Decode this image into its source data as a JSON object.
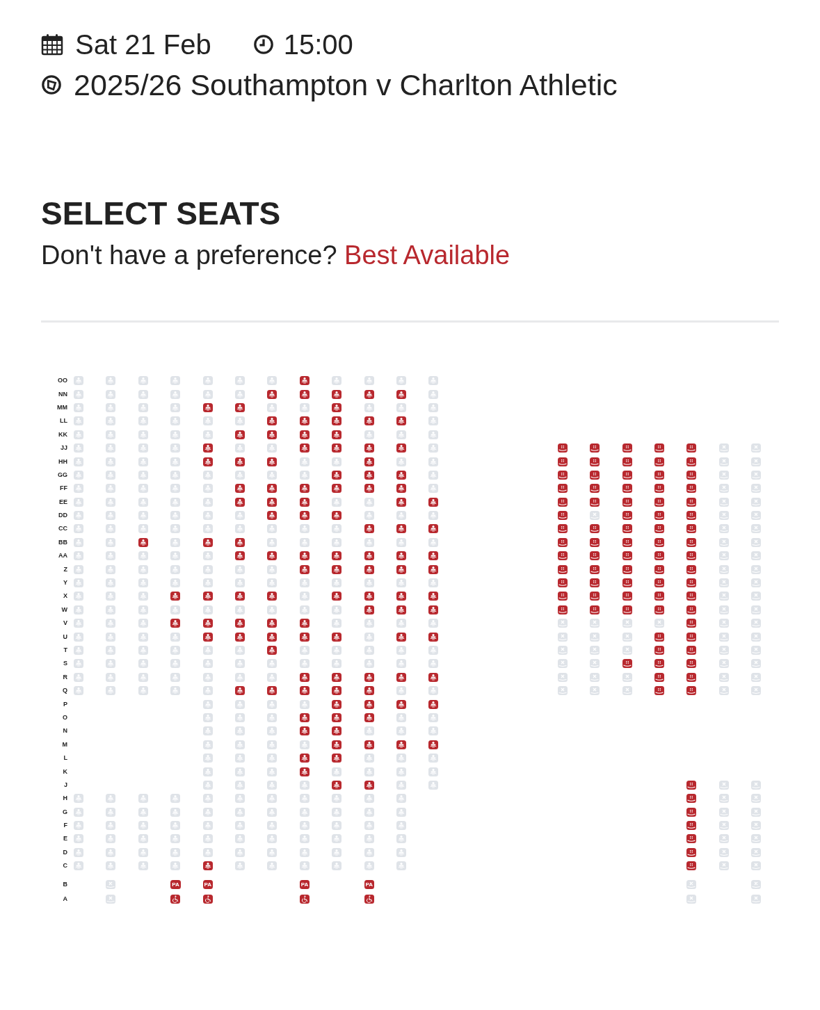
{
  "event": {
    "date": "Sat 21 Feb",
    "time": "15:00",
    "title": "2025/26 Southampton v Charlton Athletic"
  },
  "heading": {
    "title": "SELECT SEATS",
    "prompt": "Don't have a preference?",
    "link": "Best Available"
  },
  "seat_map": {
    "rows": [
      {
        "label": "OO",
        "kind": "standard",
        "left_seats": [
          false,
          false,
          false,
          false,
          false,
          false,
          false,
          true,
          false,
          false,
          false,
          false
        ]
      },
      {
        "label": "NN",
        "kind": "standard",
        "left_seats": [
          false,
          false,
          false,
          false,
          false,
          false,
          true,
          true,
          true,
          true,
          true,
          false
        ]
      },
      {
        "label": "MM",
        "kind": "standard",
        "left_seats": [
          false,
          false,
          false,
          false,
          true,
          true,
          false,
          false,
          true,
          false,
          false,
          false
        ]
      },
      {
        "label": "LL",
        "kind": "standard",
        "left_seats": [
          false,
          false,
          false,
          false,
          false,
          false,
          true,
          true,
          true,
          true,
          true,
          false
        ]
      },
      {
        "label": "KK",
        "kind": "standard",
        "left_seats": [
          false,
          false,
          false,
          false,
          false,
          true,
          true,
          true,
          true,
          false,
          false,
          false
        ]
      },
      {
        "label": "JJ",
        "kind": "standard",
        "left_seats": [
          false,
          false,
          false,
          false,
          true,
          false,
          false,
          true,
          true,
          true,
          true,
          false
        ],
        "right_seats": [
          true,
          true,
          true,
          true,
          true,
          false,
          false
        ]
      },
      {
        "label": "HH",
        "kind": "standard",
        "left_seats": [
          false,
          false,
          false,
          false,
          true,
          true,
          true,
          false,
          false,
          true,
          false,
          false
        ],
        "right_seats": [
          true,
          true,
          true,
          true,
          true,
          false,
          false
        ]
      },
      {
        "label": "GG",
        "kind": "standard",
        "left_seats": [
          false,
          false,
          false,
          false,
          false,
          false,
          false,
          false,
          true,
          true,
          true,
          false
        ],
        "right_seats": [
          true,
          true,
          true,
          true,
          true,
          false,
          false
        ]
      },
      {
        "label": "FF",
        "kind": "standard",
        "left_seats": [
          false,
          false,
          false,
          false,
          false,
          true,
          true,
          true,
          true,
          true,
          true,
          false
        ],
        "right_seats": [
          true,
          true,
          true,
          true,
          true,
          false,
          false
        ]
      },
      {
        "label": "EE",
        "kind": "standard",
        "left_seats": [
          false,
          false,
          false,
          false,
          false,
          true,
          true,
          true,
          false,
          false,
          true,
          true
        ],
        "right_seats": [
          true,
          true,
          true,
          true,
          true,
          false,
          false
        ]
      },
      {
        "label": "DD",
        "kind": "standard",
        "left_seats": [
          false,
          false,
          false,
          false,
          false,
          false,
          true,
          true,
          true,
          false,
          false,
          false
        ],
        "right_seats": [
          true,
          false,
          true,
          true,
          true,
          false,
          false
        ]
      },
      {
        "label": "CC",
        "kind": "standard",
        "left_seats": [
          false,
          false,
          false,
          false,
          false,
          false,
          false,
          false,
          false,
          true,
          true,
          true
        ],
        "right_seats": [
          true,
          true,
          true,
          true,
          true,
          false,
          false
        ]
      },
      {
        "label": "BB",
        "kind": "standard",
        "left_seats": [
          false,
          false,
          true,
          false,
          true,
          true,
          false,
          false,
          false,
          false,
          false,
          false
        ],
        "right_seats": [
          true,
          true,
          true,
          true,
          true,
          false,
          false
        ]
      },
      {
        "label": "AA",
        "kind": "standard",
        "left_seats": [
          false,
          false,
          false,
          false,
          false,
          true,
          true,
          true,
          true,
          true,
          true,
          true
        ],
        "right_seats": [
          true,
          true,
          true,
          true,
          true,
          false,
          false
        ]
      },
      {
        "label": "Z",
        "kind": "standard",
        "left_seats": [
          false,
          false,
          false,
          false,
          false,
          false,
          false,
          true,
          true,
          true,
          true,
          true
        ],
        "right_seats": [
          true,
          true,
          true,
          true,
          true,
          false,
          false
        ]
      },
      {
        "label": "Y",
        "kind": "standard",
        "left_seats": [
          false,
          false,
          false,
          false,
          false,
          false,
          false,
          false,
          false,
          false,
          false,
          false
        ],
        "right_seats": [
          true,
          true,
          true,
          true,
          true,
          false,
          false
        ]
      },
      {
        "label": "X",
        "kind": "standard",
        "left_seats": [
          false,
          false,
          false,
          true,
          true,
          true,
          true,
          false,
          true,
          true,
          true,
          true
        ],
        "right_seats": [
          true,
          true,
          true,
          true,
          true,
          false,
          false
        ]
      },
      {
        "label": "W",
        "kind": "standard",
        "left_seats": [
          false,
          false,
          false,
          false,
          false,
          false,
          false,
          false,
          false,
          true,
          true,
          true
        ],
        "right_seats": [
          true,
          true,
          true,
          true,
          true,
          false,
          false
        ]
      },
      {
        "label": "V",
        "kind": "standard",
        "left_seats": [
          false,
          false,
          false,
          true,
          true,
          true,
          true,
          true,
          false,
          false,
          false,
          false
        ],
        "right_seats": [
          false,
          false,
          false,
          false,
          true,
          false,
          false
        ]
      },
      {
        "label": "U",
        "kind": "standard",
        "left_seats": [
          false,
          false,
          false,
          false,
          true,
          true,
          true,
          true,
          true,
          false,
          true,
          true
        ],
        "right_seats": [
          false,
          false,
          false,
          true,
          true,
          false,
          false
        ]
      },
      {
        "label": "T",
        "kind": "standard",
        "left_seats": [
          false,
          false,
          false,
          false,
          false,
          false,
          true,
          false,
          false,
          false,
          false,
          false
        ],
        "right_seats": [
          false,
          false,
          false,
          true,
          true,
          false,
          false
        ]
      },
      {
        "label": "S",
        "kind": "standard",
        "left_seats": [
          false,
          false,
          false,
          false,
          false,
          false,
          false,
          false,
          false,
          false,
          false,
          false
        ],
        "right_seats": [
          false,
          false,
          true,
          true,
          true,
          false,
          false
        ]
      },
      {
        "label": "R",
        "kind": "standard",
        "left_seats": [
          false,
          false,
          false,
          false,
          false,
          false,
          false,
          true,
          true,
          true,
          true,
          true
        ],
        "right_seats": [
          false,
          false,
          false,
          true,
          true,
          false,
          false
        ]
      },
      {
        "label": "Q",
        "kind": "standard",
        "left_seats": [
          false,
          false,
          false,
          false,
          false,
          true,
          true,
          true,
          true,
          true,
          false,
          false
        ],
        "right_seats": [
          false,
          false,
          false,
          true,
          true,
          false,
          false
        ]
      },
      {
        "label": "P",
        "kind": "standard",
        "left_inset": true,
        "left_seats": [
          false,
          false,
          false,
          false,
          true,
          true,
          true,
          true
        ]
      },
      {
        "label": "O",
        "kind": "standard",
        "left_inset": true,
        "left_seats": [
          false,
          false,
          false,
          true,
          true,
          true,
          false,
          false
        ]
      },
      {
        "label": "N",
        "kind": "standard",
        "left_inset": true,
        "left_seats": [
          false,
          false,
          false,
          true,
          true,
          false,
          false,
          false
        ]
      },
      {
        "label": "M",
        "kind": "standard",
        "left_inset": true,
        "left_seats": [
          false,
          false,
          false,
          false,
          true,
          true,
          true,
          true
        ]
      },
      {
        "label": "L",
        "kind": "standard",
        "left_inset": true,
        "left_seats": [
          false,
          false,
          false,
          true,
          true,
          false,
          false,
          false
        ]
      },
      {
        "label": "K",
        "kind": "standard",
        "left_inset": true,
        "left_seats": [
          false,
          false,
          false,
          true,
          false,
          false,
          false,
          false
        ]
      },
      {
        "label": "J",
        "kind": "standard",
        "left_inset": true,
        "left_seats": [
          false,
          false,
          false,
          false,
          true,
          true,
          false,
          false
        ],
        "right_inset": true,
        "right_seats": [
          true,
          false,
          false
        ]
      },
      {
        "label": "H",
        "kind": "standard",
        "left_seats": [
          false,
          false,
          false,
          false,
          false,
          false,
          false,
          false,
          false,
          false,
          false
        ],
        "right_inset": true,
        "right_seats": [
          true,
          false,
          false
        ]
      },
      {
        "label": "G",
        "kind": "standard",
        "left_seats": [
          false,
          false,
          false,
          false,
          false,
          false,
          false,
          false,
          false,
          false,
          false
        ],
        "right_inset": true,
        "right_seats": [
          true,
          false,
          false
        ]
      },
      {
        "label": "F",
        "kind": "standard",
        "left_seats": [
          false,
          false,
          false,
          false,
          false,
          false,
          false,
          false,
          false,
          false,
          false
        ],
        "right_inset": true,
        "right_seats": [
          true,
          false,
          false
        ]
      },
      {
        "label": "E",
        "kind": "standard",
        "left_seats": [
          false,
          false,
          false,
          false,
          false,
          false,
          false,
          false,
          false,
          false,
          false
        ],
        "right_inset": true,
        "right_seats": [
          true,
          false,
          false
        ]
      },
      {
        "label": "D",
        "kind": "standard",
        "left_seats": [
          false,
          false,
          false,
          false,
          false,
          false,
          false,
          false,
          false,
          false,
          false
        ],
        "right_inset": true,
        "right_seats": [
          true,
          false,
          false
        ]
      },
      {
        "label": "C",
        "kind": "standard",
        "left_seats": [
          false,
          false,
          false,
          false,
          true,
          false,
          false,
          false,
          false,
          false,
          false
        ],
        "right_inset": true,
        "right_seats": [
          true,
          false,
          false
        ]
      },
      {
        "label": "B",
        "kind": "accessible",
        "left_seats": [
          {
            "kind": "gap"
          },
          {
            "kind": "blocked",
            "available": false
          },
          {
            "kind": "gap"
          },
          {
            "kind": "pa",
            "label": "PA",
            "available": true
          },
          {
            "kind": "pa",
            "label": "PA",
            "available": true
          },
          {
            "kind": "gap"
          },
          {
            "kind": "gap"
          },
          {
            "kind": "pa",
            "label": "PA",
            "available": true
          },
          {
            "kind": "gap"
          },
          {
            "kind": "pa",
            "label": "PA",
            "available": true
          }
        ],
        "right_inset": true,
        "right_seats": [
          {
            "kind": "blocked",
            "available": false
          },
          {
            "kind": "gap"
          },
          {
            "kind": "blocked",
            "available": false
          }
        ]
      },
      {
        "label": "A",
        "kind": "accessible",
        "left_seats": [
          {
            "kind": "gap"
          },
          {
            "kind": "blocked",
            "available": false
          },
          {
            "kind": "gap"
          },
          {
            "kind": "wheelchair",
            "available": true
          },
          {
            "kind": "wheelchair",
            "available": true
          },
          {
            "kind": "gap"
          },
          {
            "kind": "gap"
          },
          {
            "kind": "wheelchair",
            "available": true
          },
          {
            "kind": "gap"
          },
          {
            "kind": "wheelchair",
            "available": true
          }
        ],
        "right_inset": true,
        "right_seats": [
          {
            "kind": "blocked",
            "available": false
          },
          {
            "kind": "gap"
          },
          {
            "kind": "blocked",
            "available": false
          }
        ]
      }
    ]
  }
}
